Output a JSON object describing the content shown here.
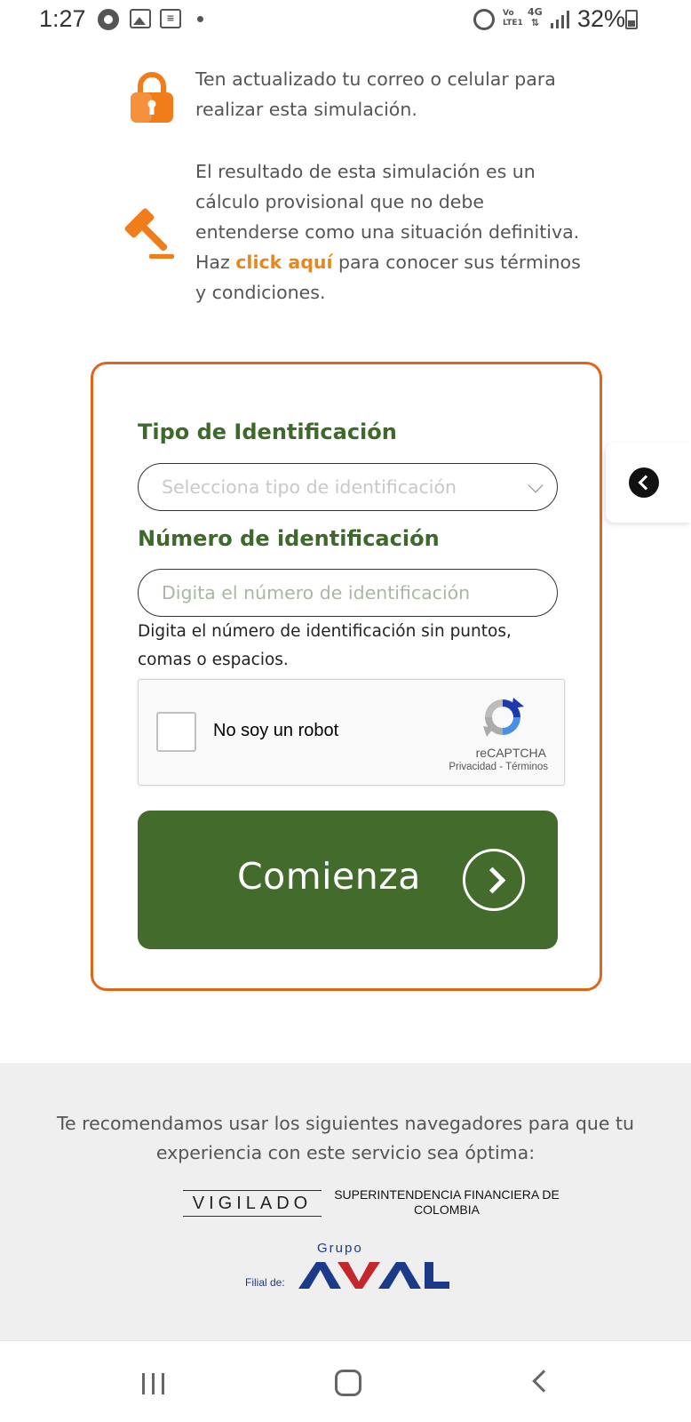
{
  "status_bar": {
    "time": "1:27",
    "battery": "32%",
    "network": "4G",
    "volte": "Vo LTE1",
    "icons": [
      "chrome-icon",
      "gallery-icon",
      "news-icon",
      "notification-dot",
      "alarm-icon",
      "volte-icon",
      "4g-icon",
      "signal-icon",
      "battery-icon"
    ]
  },
  "info": {
    "update_contact": "Ten actualizado tu correo o celular para realizar esta simulación.",
    "disclaimer_before": "El resultado de esta simulación es un cálculo provisional que no debe entenderse como una situación definitiva. Haz ",
    "disclaimer_link": "click aquí",
    "disclaimer_after": " para conocer sus términos y condiciones."
  },
  "form": {
    "id_type_label": "Tipo de Identificación",
    "id_type_placeholder": "Selecciona tipo de identificación",
    "id_number_label": "Número de identificación",
    "id_number_placeholder": "Digita el número de identificación",
    "help_text": "Digita el número de identificación sin puntos, comas o espacios.",
    "recaptcha": {
      "label": "No soy un robot",
      "brand": "reCAPTCHA",
      "links": "Privacidad - Términos"
    },
    "submit_label": "Comienza"
  },
  "footer": {
    "recommendation": "Te recomendamos usar los siguientes navegadores para que tu experiencia con este servicio sea óptima:",
    "vigilado": "VIGILADO",
    "superintendencia": "SUPERINTENDENCIA FINANCIERA DE COLOMBIA",
    "filial": "Filial de:",
    "grupo": "Grupo",
    "aval": "AVAL"
  },
  "colors": {
    "brand_green": "#436b2c",
    "label_green": "#3d6a2b",
    "accent_orange": "#e0651a",
    "link_orange": "#e8871e",
    "aval_blue": "#1b3a8a",
    "aval_red": "#c4262e"
  }
}
